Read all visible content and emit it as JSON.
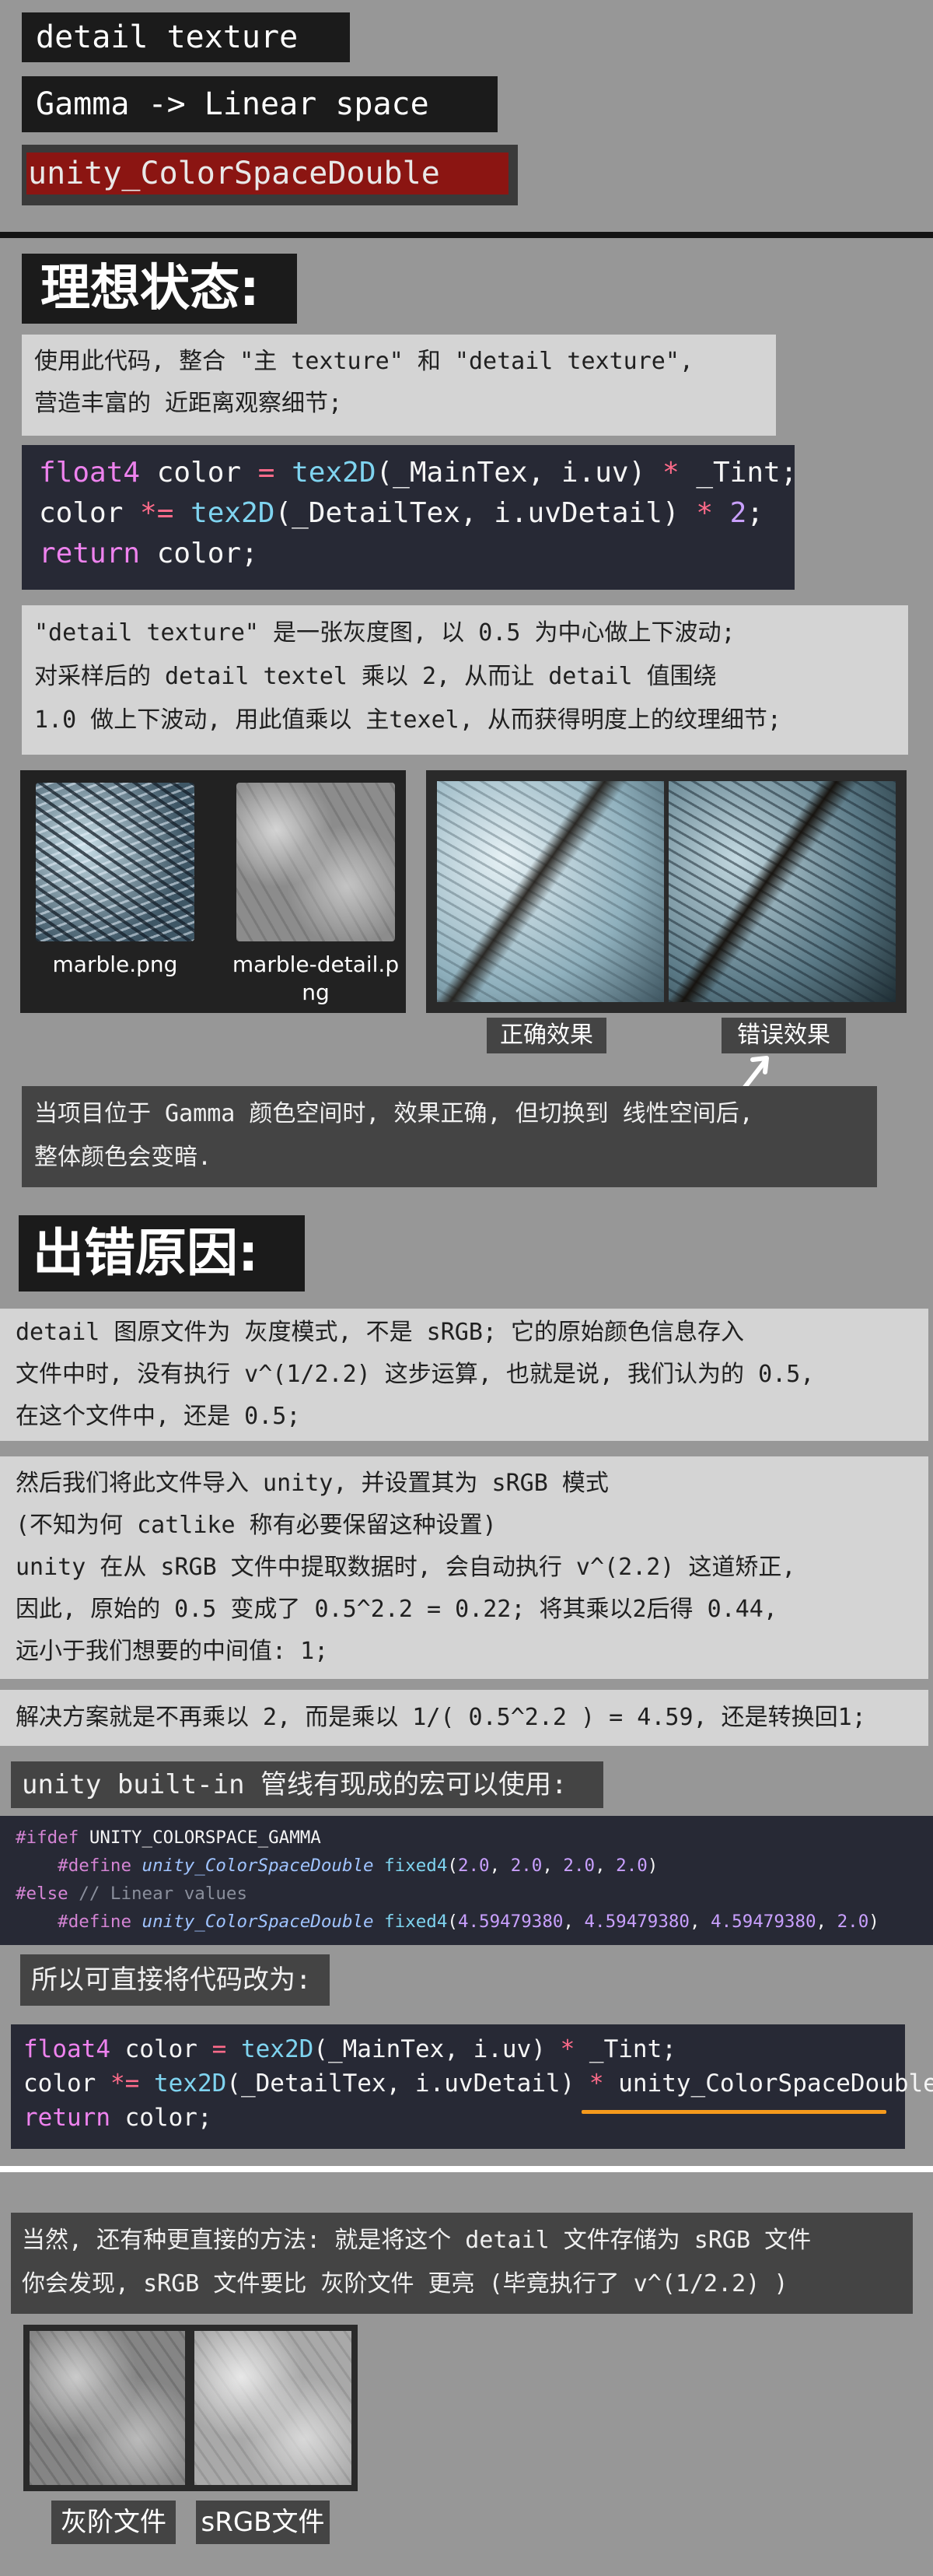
{
  "header": {
    "tag1": "detail texture",
    "tag2": "Gamma -> Linear space",
    "tag3": "unity_ColorSpaceDouble"
  },
  "section1": {
    "title": "理想状态:",
    "intro_lines": [
      "使用此代码, 整合 \"主 texture\" 和 \"detail texture\",",
      "营造丰富的 近距离观察细节;"
    ],
    "code1": {
      "l1_a": "float4",
      "l1_b": " color ",
      "l1_c": "=",
      "l1_d": " tex2D",
      "l1_e": "(_MainTex, i.uv) ",
      "l1_f": "*",
      "l1_g": " _Tint;",
      "l2_a": "color ",
      "l2_b": "*=",
      "l2_c": " tex2D",
      "l2_d": "(_DetailTex, i.uvDetail) ",
      "l2_e": "*",
      "l2_f": " 2",
      "l2_g": ";",
      "l3_a": "return",
      "l3_b": " color;"
    },
    "explain_lines": [
      "\"detail texture\" 是一张灰度图, 以 0.5 为中心做上下波动;",
      "对采样后的 detail textel 乘以 2, 从而让 detail 值围绕",
      "1.0 做上下波动, 用此值乘以 主texel, 从而获得明度上的纹理细节;"
    ],
    "textures": [
      {
        "label": "marble.png"
      },
      {
        "label": "marble-detail.png"
      }
    ],
    "compare_labels": {
      "correct": "正确效果",
      "wrong": "错误效果"
    },
    "note_lines": [
      "当项目位于 Gamma 颜色空间时, 效果正确, 但切换到 线性空间后,",
      "整体颜色会变暗."
    ]
  },
  "section2": {
    "title": "出错原因:",
    "box1_lines": [
      "detail 图原文件为 灰度模式, 不是 sRGB; 它的原始颜色信息存入",
      "文件中时, 没有执行 v^(1/2.2) 这步运算, 也就是说, 我们认为的 0.5,",
      "在这个文件中, 还是 0.5;"
    ],
    "box2_lines": [
      "然后我们将此文件导入 unity, 并设置其为 sRGB 模式",
      "(不知为何 catlike 称有必要保留这种设置)",
      "unity 在从 sRGB 文件中提取数据时, 会自动执行 v^(2.2) 这道矫正,",
      "因此, 原始的 0.5 变成了 0.5^2.2 = 0.22; 将其乘以2后得 0.44,",
      "远小于我们想要的中间值: 1;"
    ],
    "box3_line": "解决方案就是不再乘以 2, 而是乘以 1/( 0.5^2.2 ) = 4.59, 还是转换回1;",
    "builtin_tag": "unity built-in 管线有现成的宏可以使用:",
    "code2": {
      "l1_a": "#ifdef",
      "l1_b": " UNITY_COLORSPACE_GAMMA",
      "l2_a": "    #define",
      "l2_b": " unity_ColorSpaceDouble",
      "l2_c": " fixed4",
      "l2_d": "(",
      "l2_e": "2.0",
      "l2_f": ", ",
      "l2_g": "2.0",
      "l2_h": ", ",
      "l2_i": "2.0",
      "l2_j": ", ",
      "l2_k": "2.0",
      "l2_l": ")",
      "l3_a": "#else",
      "l3_b": " // Linear values",
      "l4_a": "    #define",
      "l4_b": " unity_ColorSpaceDouble",
      "l4_c": " fixed4",
      "l4_d": "(",
      "l4_e": "4.59479380",
      "l4_f": ", ",
      "l4_g": "4.59479380",
      "l4_h": ", ",
      "l4_i": "4.59479380",
      "l4_j": ", ",
      "l4_k": "2.0",
      "l4_l": ")"
    },
    "so_tag": "所以可直接将代码改为:",
    "code3": {
      "l1_a": "float4",
      "l1_b": " color ",
      "l1_c": "=",
      "l1_d": " tex2D",
      "l1_e": "(_MainTex, i.uv) ",
      "l1_f": "*",
      "l1_g": " _Tint;",
      "l2_a": "color ",
      "l2_b": "*=",
      "l2_c": " tex2D",
      "l2_d": "(_DetailTex, i.uvDetail) ",
      "l2_e": "*",
      "l2_f": " ",
      "l2_g": "unity_ColorSpaceDouble;",
      "l3_a": "return",
      "l3_b": " color;"
    },
    "underline_color": "#f59a1d"
  },
  "section3": {
    "lines": [
      "当然, 还有种更直接的方法: 就是将这个 detail 文件存储为 sRGB 文件",
      "你会发现, sRGB 文件要比 灰阶文件 更亮 (毕竟执行了 v^(1/2.2) )"
    ],
    "labels": {
      "gray": "灰阶文件",
      "srgb": "sRGB文件"
    }
  },
  "colors": {
    "page_bg": "#979797",
    "tag_bg": "#1b1b1b",
    "highlight_red": "#8b1512",
    "code_bg": "#272935"
  }
}
